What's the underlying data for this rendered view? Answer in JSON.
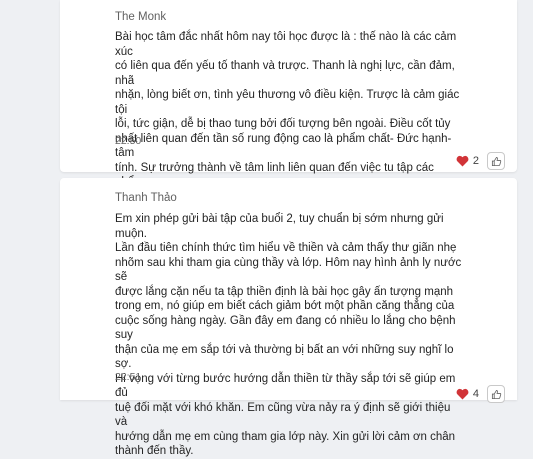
{
  "colors": {
    "background": "#eef0f3",
    "card": "#ffffff",
    "heart": "#d13438",
    "muted_text": "#616161"
  },
  "posts": [
    {
      "author": "The Monk",
      "text": "Bài học tâm đắc nhất hôm nay tôi học được là : thế nào là các cảm xúc\ncó liên qua đến yếu tố thanh và trược. Thanh là nghị lực, cần đảm, nhã\nnhặn, lòng biết ơn, tình yêu thương vô điều kiện. Trược là cảm giác tội\nlỗi, tức giận, dễ bị thao tung bởi đối tượng bên ngoài. Điều cốt tủy\nnhất liên quan đến tần số rung động cao là phẩm chất- Đức hạnh-tâm\ntính. Sự trưởng thành về tâm linh liên quan đến việc tu tập các phẩm\nchất trong đời sống.",
      "time": "22:50",
      "reaction_count": "2",
      "reaction_icon": "heart-emoji",
      "like_icon": "thumbs-up-outline"
    },
    {
      "author": "Thanh Thảo",
      "text": "Em xin phép gửi bài tập của buổi 2, tuy chuẩn bị sớm nhưng gửi muộn.\nLần đầu tiên chính thức tìm hiểu về thiền và cảm thấy thư giãn nhẹ\nnhõm sau khi tham gia cùng thầy và lớp. Hôm nay hình ảnh ly nước sẽ\nđược lắng cặn nếu ta tập thiền định là bài học gây ấn tượng mạnh\ntrong em, nó giúp em biết cách giảm bớt một phần căng thẳng của\ncuộc sống hàng ngày. Gần đây em đang có nhiều lo lắng cho bệnh suy\nthận của mẹ em sắp tới và thường bị bất an với những suy nghĩ lo sợ.\nHi vọng với từng bước hướng dẫn thiền từ thầy sắp tới sẽ giúp em đủ\ntuệ đối mặt với khó khăn. Em cũng vừa nảy ra ý định sẽ giới thiệu và\nhướng dẫn mẹ em cùng tham gia lớp này. Xin gửi lời cảm ơn chân\nthành đến thầy.",
      "time": "22:51",
      "reaction_count": "4",
      "reaction_icon": "heart-emoji",
      "like_icon": "thumbs-up-outline"
    }
  ]
}
